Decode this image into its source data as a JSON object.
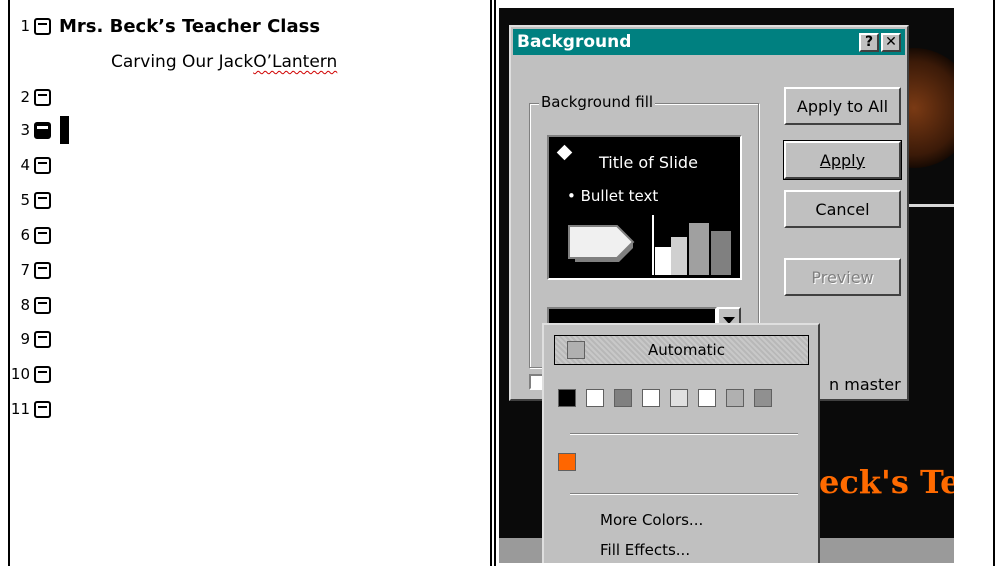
{
  "outline": {
    "slide1": {
      "number": "1",
      "title": "Mrs. Beck’s Teacher Class",
      "subtitle_pre": "Carving Our Jack ",
      "subtitle_misspelled": "O’Lantern"
    },
    "slides": [
      {
        "number": "2"
      },
      {
        "number": "3",
        "selected": true
      },
      {
        "number": "4"
      },
      {
        "number": "5"
      },
      {
        "number": "6"
      },
      {
        "number": "7"
      },
      {
        "number": "8"
      },
      {
        "number": "9"
      },
      {
        "number": "10"
      },
      {
        "number": "11"
      }
    ]
  },
  "dialog": {
    "title": "Background",
    "help_button": "?",
    "close_button": "✕",
    "group_label": "Background fill",
    "group_label_accel": "B",
    "preview": {
      "title": "Title of Slide",
      "bullet": "• Bullet text"
    },
    "fill_color": "#000000",
    "buttons": {
      "apply_to_all": "Apply to All",
      "apply": "Apply",
      "cancel": "Cancel",
      "preview": "Preview"
    },
    "omit_master_text": "n master"
  },
  "color_popup": {
    "automatic_label": "Automatic",
    "scheme_colors": [
      "#000000",
      "#ffffff",
      "#808080",
      "#ffffff",
      "#e0e0e0",
      "#ffffff",
      "#b0b0b0",
      "#909090"
    ],
    "recent_color": "#ff6600",
    "more_colors": "More Colors...",
    "fill_effects": "Fill Effects..."
  },
  "slide_canvas": {
    "visible_text": "eck's Te",
    "accent_color": "#ff6a00"
  }
}
